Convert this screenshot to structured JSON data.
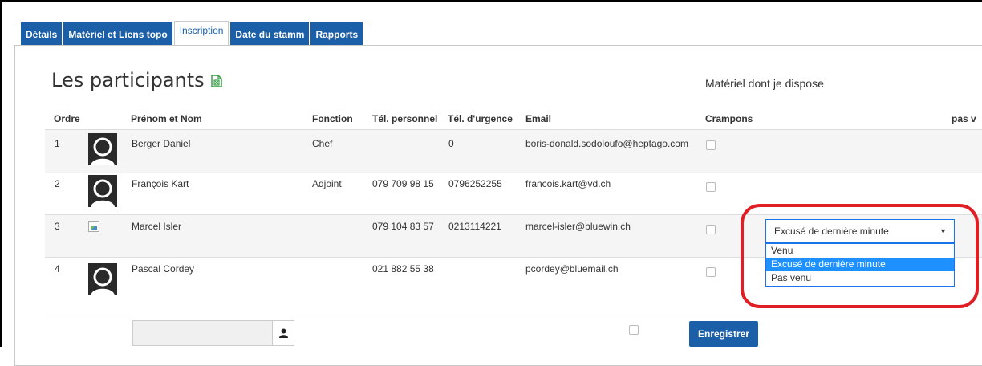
{
  "tabs": [
    {
      "label": "Détails",
      "active": false
    },
    {
      "label": "Matériel et Liens topo",
      "active": false
    },
    {
      "label": "Inscription",
      "active": true
    },
    {
      "label": "Date du stamm",
      "active": false
    },
    {
      "label": "Rapports",
      "active": false
    }
  ],
  "heading": "Les participants",
  "materiel_heading": "Matériel dont je dispose",
  "columns": {
    "ordre": "Ordre",
    "nom": "Prénom et Nom",
    "fonction": "Fonction",
    "tel_perso": "Tél. personnel",
    "tel_urgence": "Tél. d'urgence",
    "email": "Email",
    "crampons": "Crampons",
    "extra": "pas v"
  },
  "rows": [
    {
      "ordre": "1",
      "nom": "Berger Daniel",
      "fonction": "Chef",
      "tel_perso": "",
      "tel_urgence": "0",
      "email": "boris-donald.sodoloufo@heptago.com"
    },
    {
      "ordre": "2",
      "nom": "François Kart",
      "fonction": "Adjoint",
      "tel_perso": "079 709 98 15",
      "tel_urgence": "0796252255",
      "email": "francois.kart@vd.ch"
    },
    {
      "ordre": "3",
      "nom": "Marcel Isler",
      "fonction": "",
      "tel_perso": "079 104 83 57",
      "tel_urgence": "0213114221",
      "email": "marcel-isler@bluewin.ch"
    },
    {
      "ordre": "4",
      "nom": "Pascal Cordey",
      "fonction": "",
      "tel_perso": "021 882 55 38",
      "tel_urgence": "",
      "email": "pcordey@bluemail.ch"
    }
  ],
  "status_select": {
    "value": "Excusé de dernière minute",
    "options": [
      "Venu",
      "Excusé de dernière minute",
      "Pas venu"
    ]
  },
  "save_label": "Enregistrer",
  "colors": {
    "accent": "#1a5fa8",
    "highlight": "#e01e26",
    "selected_option": "#1e90ff"
  }
}
